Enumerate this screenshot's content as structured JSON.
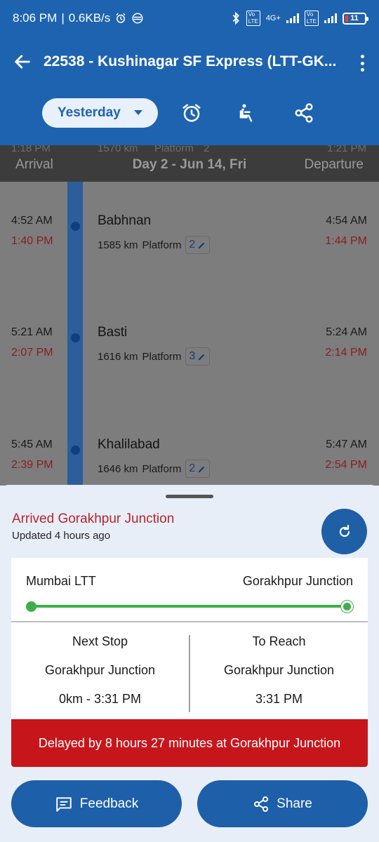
{
  "status_bar": {
    "time": "8:06 PM",
    "speed": "0.6KB/s",
    "network_label": "4G+",
    "battery": "11"
  },
  "app_bar": {
    "title": "22538 - Kushinagar SF Express (LTT-GK...",
    "day_selector": "Yesterday",
    "icons": [
      "back-arrow-icon",
      "more-vert-icon",
      "alarm-icon",
      "seat-icon",
      "share-icon"
    ]
  },
  "timeline": {
    "header": {
      "arrival_label": "Arrival",
      "day_label": "Day 2 - Jun 14, Fri",
      "departure_label": "Departure",
      "peek": {
        "arr": "1:18 PM",
        "dist": "1570 km",
        "pf_label": "Platform",
        "pf": "2",
        "dep": "1:21 PM"
      }
    },
    "stations": [
      {
        "name": "Babhnan",
        "sched_arr": "4:52 AM",
        "actual_arr": "1:40 PM",
        "sched_dep": "4:54 AM",
        "actual_dep": "1:44 PM",
        "distance": "1585 km",
        "platform_label": "Platform",
        "platform": "2"
      },
      {
        "name": "Basti",
        "sched_arr": "5:21 AM",
        "actual_arr": "2:07 PM",
        "sched_dep": "5:24 AM",
        "actual_dep": "2:14 PM",
        "distance": "1616 km",
        "platform_label": "Platform",
        "platform": "3"
      },
      {
        "name": "Khalilabad",
        "sched_arr": "5:45 AM",
        "actual_arr": "2:39 PM",
        "sched_dep": "5:47 AM",
        "actual_dep": "2:54 PM",
        "distance": "1646 km",
        "platform_label": "Platform",
        "platform": "2"
      }
    ]
  },
  "sheet": {
    "status": "Arrived Gorakhpur Junction",
    "updated": "Updated 4 hours ago",
    "route": {
      "from": "Mumbai LTT",
      "to": "Gorakhpur Junction",
      "progress": 1.0
    },
    "next_stop": {
      "heading": "Next Stop",
      "station": "Gorakhpur Junction",
      "detail": "0km - 3:31 PM"
    },
    "to_reach": {
      "heading": "To Reach",
      "station": "Gorakhpur Junction",
      "time": "3:31 PM"
    },
    "delay_text": "Delayed by 8 hours 27 minutes at Gorakhpur Junction",
    "feedback_label": "Feedback",
    "share_label": "Share"
  },
  "colors": {
    "primary": "#1e63b0",
    "delay_red": "#c6161c",
    "late_time": "#8b1d1d",
    "progress_green": "#3fae49"
  }
}
